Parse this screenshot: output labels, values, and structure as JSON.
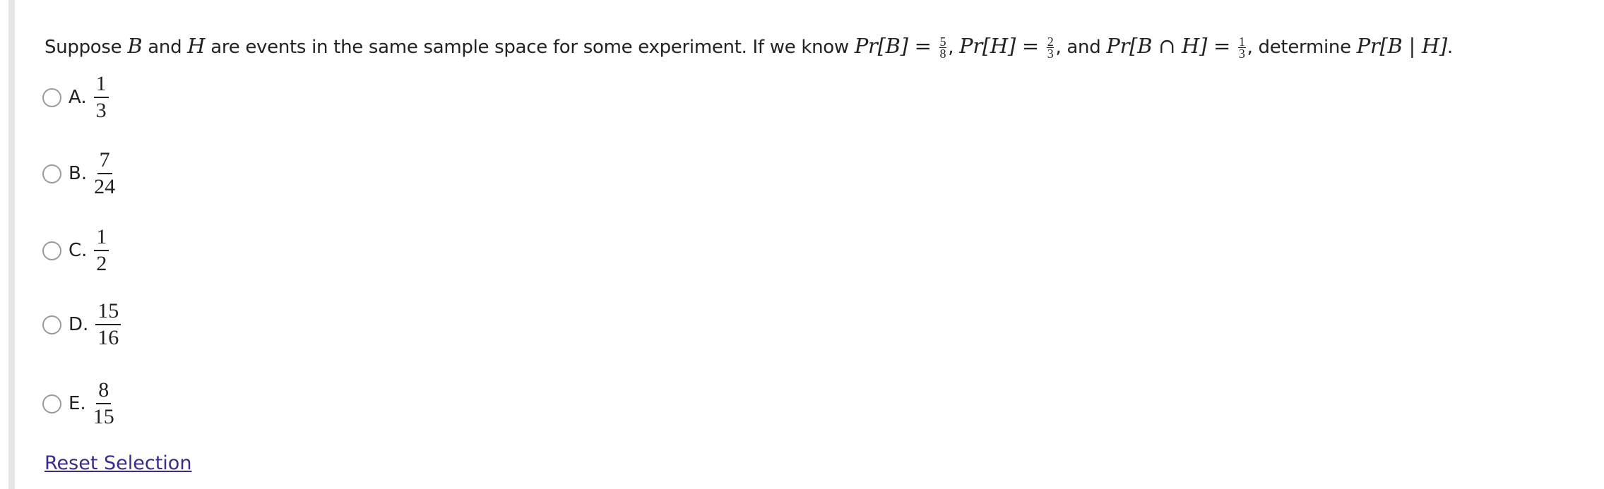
{
  "question": {
    "prefix": "Suppose ",
    "B": "B",
    "and1": " and ",
    "H": "H",
    "mid": " are events in the same sample space for some experiment. If we know ",
    "prB": "Pr[B]",
    "eq": " = ",
    "prB_num": "5",
    "prB_den": "8",
    "comma": ", ",
    "prH": "Pr[H]",
    "prH_num": "2",
    "prH_den": "3",
    "and2": ", and ",
    "prBH": "Pr[B ∩ H]",
    "prBH_num": "1",
    "prBH_den": "3",
    "det": ", determine ",
    "target": "Pr[B | H]",
    "end": "."
  },
  "options": [
    {
      "letter": "A.",
      "num": "1",
      "den": "3"
    },
    {
      "letter": "B.",
      "num": "7",
      "den": "24"
    },
    {
      "letter": "C.",
      "num": "1",
      "den": "2"
    },
    {
      "letter": "D.",
      "num": "15",
      "den": "16"
    },
    {
      "letter": "E.",
      "num": "8",
      "den": "15"
    }
  ],
  "reset_label": "Reset Selection",
  "colors": {
    "link": "#3b2a8a",
    "radio_border": "#9a9a9a"
  }
}
